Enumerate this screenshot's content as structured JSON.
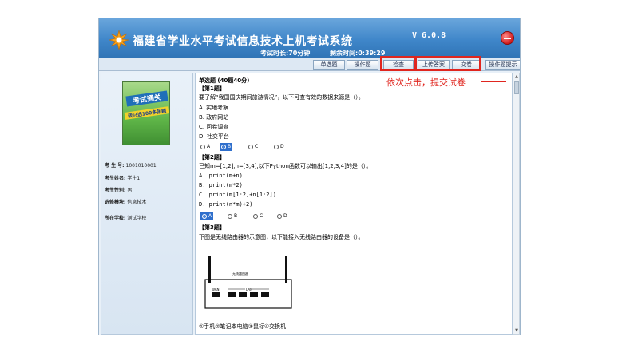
{
  "header": {
    "title": "福建省学业水平考试信息技术上机考试系统",
    "version": "V 6.0.8",
    "duration": "考试时长:70分钟",
    "remaining": "剩余时间:0:39:29"
  },
  "toolbar": {
    "tabs": [
      "单选题",
      "操作题"
    ],
    "check": "检查",
    "upload": "上传答案",
    "submit": "交卷",
    "hint": "操作题提示"
  },
  "sidebar": {
    "cover_line1": "考试通关",
    "cover_line2": "我只选100多张题",
    "exam_no_label": "考 生 号:",
    "exam_no_value": "1001010001",
    "name_label": "考生姓名:",
    "name_value": "学生1",
    "gender_label": "考生性别:",
    "gender_value": "男",
    "module_label": "选修模块:",
    "module_value": "信息技术",
    "school_label": "所在学校:",
    "school_value": "测试学校"
  },
  "content": {
    "section_title": "单选题 (40题40分)",
    "q1_no": "【第1题】",
    "q1_text": "要了解“我国国庆期间旅游情况”，以下可查有效的数据来源是（）。",
    "q1_opts": [
      "A. 实地考察",
      "B. 政府网站",
      "C. 问卷调查",
      "D. 社交平台"
    ],
    "q1_radios": [
      "A",
      "B",
      "C",
      "D"
    ],
    "q2_no": "【第2题】",
    "q2_text": "已知m=[1,2],n=[3,4],以下Python函数可以输出[1,2,3,4]的是（）。",
    "q2_opts": [
      "A. print(m+n)",
      "B. print(m*2)",
      "C. print(m[1:2]+n[1:2])",
      "D. print(n*m)+2)"
    ],
    "q2_radios": [
      "A",
      "B",
      "C",
      "D"
    ],
    "q3_no": "【第3题】",
    "q3_text": "下图是无线路由器的示意图，以下能接入无线路由器的设备是（）。",
    "router_label": "无线路由器",
    "port_wan": "WAN",
    "port_lan": "LAN",
    "q3_opts": "①手机②笔记本电脑③鼠标④交换机"
  },
  "annotation": {
    "text": "依次点击，提交试卷",
    "color": "#e0261f"
  }
}
